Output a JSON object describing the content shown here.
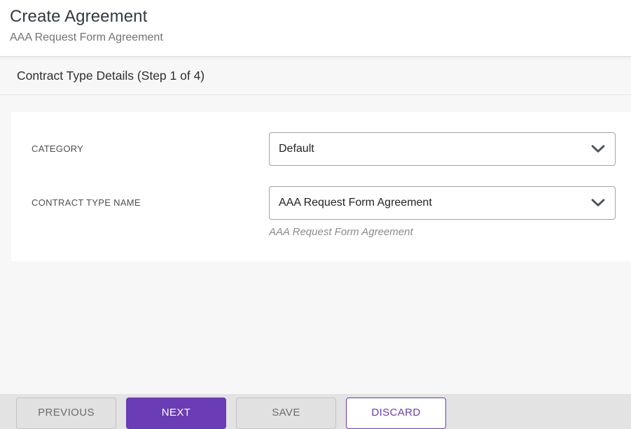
{
  "header": {
    "title": "Create Agreement",
    "subtitle": "AAA Request Form Agreement"
  },
  "section": {
    "title": "Contract Type Details (Step 1 of 4)"
  },
  "form": {
    "fields": [
      {
        "label": "CATEGORY",
        "value": "Default"
      },
      {
        "label": "CONTRACT TYPE NAME",
        "value": "AAA Request Form Agreement",
        "helper": "AAA Request Form Agreement"
      }
    ]
  },
  "footer": {
    "buttons": [
      {
        "label": "PREVIOUS",
        "style": "secondary"
      },
      {
        "label": "NEXT",
        "style": "primary"
      },
      {
        "label": "SAVE",
        "style": "secondary"
      },
      {
        "label": "DISCARD",
        "style": "outline"
      }
    ]
  },
  "icons": {
    "dropdown": "chevron-down-icon"
  },
  "colors": {
    "accent_purple": "#6a3cb5",
    "page_background": "#f7f7f7",
    "footer_background": "#e3e3e3",
    "card_background": "#ffffff",
    "field_border": "#a3a3a3",
    "muted_text": "#6f7276"
  }
}
